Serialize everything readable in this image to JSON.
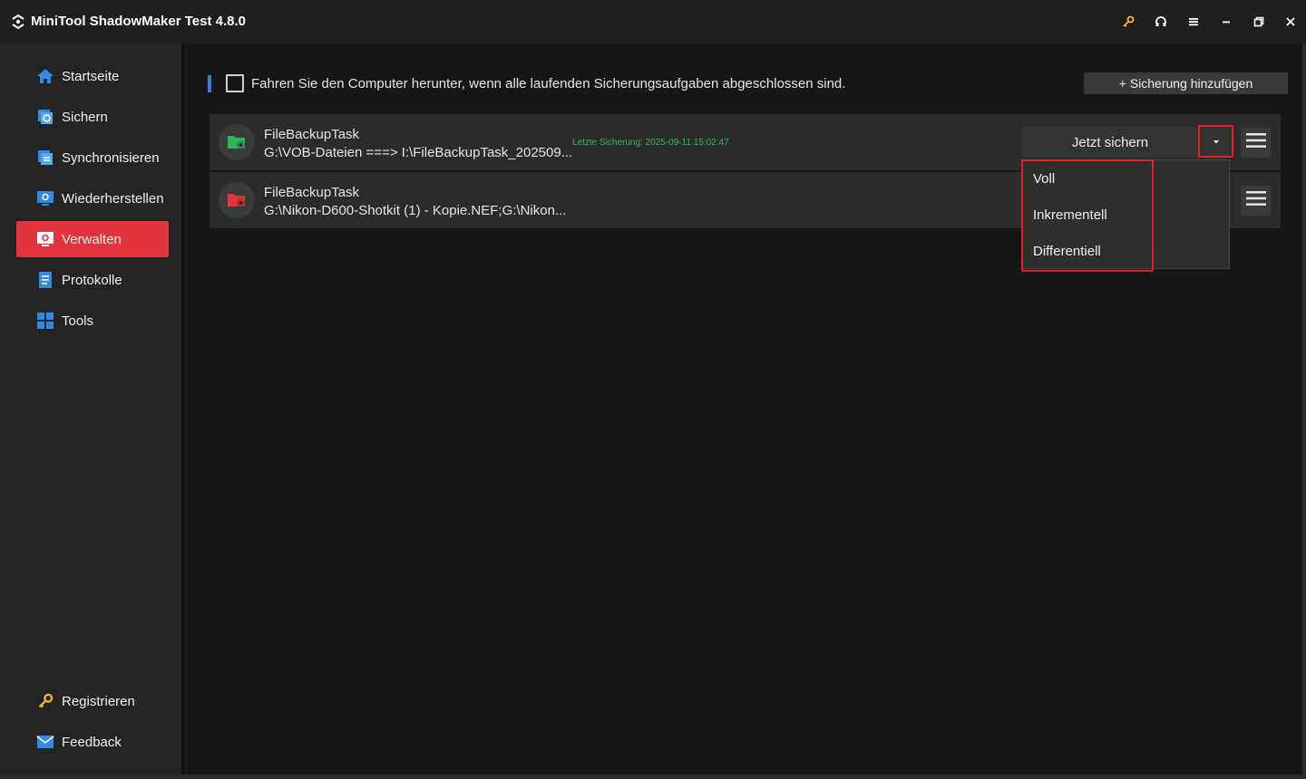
{
  "app": {
    "title": "MiniTool ShadowMaker Test 4.8.0"
  },
  "titlebar_icons": [
    "key-icon",
    "headset-icon",
    "hamburger-icon",
    "minimize-icon",
    "restore-icon",
    "close-icon"
  ],
  "colors": {
    "accent_red": "#e2343c",
    "accent_blue": "#2f7fe0",
    "status_green": "#3db368",
    "key_yellow": "#f2b632"
  },
  "sidebar": {
    "items": [
      {
        "label": "Startseite",
        "icon": "home-icon"
      },
      {
        "label": "Sichern",
        "icon": "backup-icon"
      },
      {
        "label": "Synchronisieren",
        "icon": "sync-icon"
      },
      {
        "label": "Wiederherstellen",
        "icon": "restore-icon"
      },
      {
        "label": "Verwalten",
        "icon": "manage-icon",
        "active": true
      },
      {
        "label": "Protokolle",
        "icon": "logs-icon"
      },
      {
        "label": "Tools",
        "icon": "tools-icon"
      }
    ],
    "bottom_items": [
      {
        "label": "Registrieren",
        "icon": "key-icon"
      },
      {
        "label": "Feedback",
        "icon": "mail-icon"
      }
    ]
  },
  "main": {
    "shutdown_checkbox": {
      "label": "Fahren Sie den Computer herunter, wenn alle laufenden Sicherungsaufgaben abgeschlossen sind.",
      "checked": false
    },
    "add_backup_label": "+ Sicherung hinzufügen",
    "tasks": [
      {
        "name": "FileBackupTask",
        "path": "G:\\VOB-Dateien ===> I:\\FileBackupTask_202509...",
        "last_backup": "Letzte Sicherung: 2025-09-11 15:02:47",
        "icon": "folder-backup-green-icon",
        "backup_now_label": "Jetzt sichern"
      },
      {
        "name": "FileBackupTask",
        "path": "G:\\Nikon-D600-Shotkit (1) - Kopie.NEF;G:\\Nikon...",
        "icon": "folder-backup-red-icon"
      }
    ],
    "dropdown": {
      "items": [
        "Voll",
        "Inkrementell",
        "Differentiell"
      ]
    }
  }
}
